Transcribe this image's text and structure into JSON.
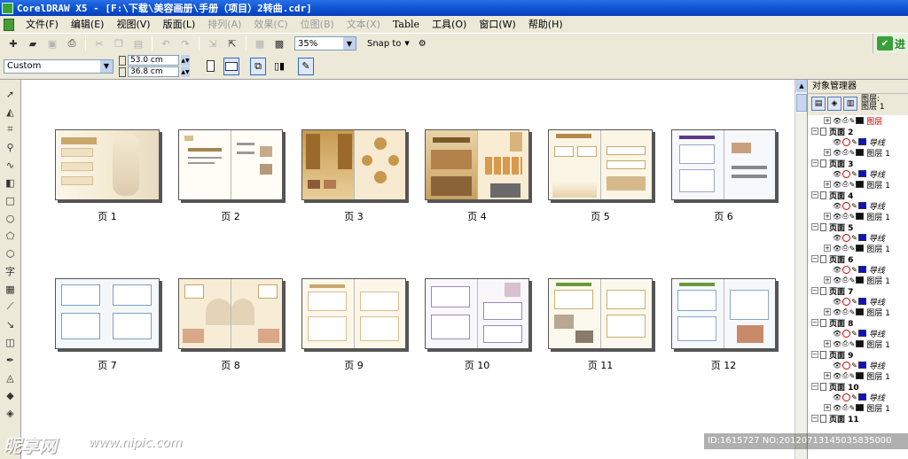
{
  "window": {
    "title": "CorelDRAW X5 - [F:\\下载\\美容画册\\手册（项目）2转曲.cdr]"
  },
  "menu": [
    {
      "label": "文件(F)",
      "enabled": true
    },
    {
      "label": "编辑(E)",
      "enabled": true
    },
    {
      "label": "视图(V)",
      "enabled": true
    },
    {
      "label": "版面(L)",
      "enabled": true
    },
    {
      "label": "排列(A)",
      "enabled": false
    },
    {
      "label": "效果(C)",
      "enabled": false
    },
    {
      "label": "位图(B)",
      "enabled": false
    },
    {
      "label": "文本(X)",
      "enabled": false
    },
    {
      "label": "Table",
      "enabled": true
    },
    {
      "label": "工具(O)",
      "enabled": true
    },
    {
      "label": "窗口(W)",
      "enabled": true
    },
    {
      "label": "帮助(H)",
      "enabled": true
    }
  ],
  "toolbar": {
    "zoom_value": "35%",
    "snap_label": "Snap to",
    "goto_label": "进"
  },
  "property_bar": {
    "preset": "Custom",
    "width": "53.0 cm",
    "height": "36.8 cm"
  },
  "pages": [
    {
      "label": "页 1"
    },
    {
      "label": "页 2"
    },
    {
      "label": "页 3"
    },
    {
      "label": "页 4"
    },
    {
      "label": "页 5"
    },
    {
      "label": "页 6"
    },
    {
      "label": "页 7"
    },
    {
      "label": "页 8"
    },
    {
      "label": "页 9"
    },
    {
      "label": "页 10"
    },
    {
      "label": "页 11"
    },
    {
      "label": "页 12"
    }
  ],
  "object_manager": {
    "title": "对象管理器",
    "layer_header_1": "图层:",
    "layer_header_2": "图层 1",
    "top_layer_label": "图层",
    "page_groups": [
      {
        "page": "页面 2",
        "guides": "导线",
        "layer": "图层 1"
      },
      {
        "page": "页面 3",
        "guides": "导线",
        "layer": "图层 1"
      },
      {
        "page": "页面 4",
        "guides": "导线",
        "layer": "图层 1"
      },
      {
        "page": "页面 5",
        "guides": "导线",
        "layer": "图层 1"
      },
      {
        "page": "页面 6",
        "guides": "导线",
        "layer": "图层 1"
      },
      {
        "page": "页面 7",
        "guides": "导线",
        "layer": "图层 1"
      },
      {
        "page": "页面 8",
        "guides": "导线",
        "layer": "图层 1"
      },
      {
        "page": "页面 9",
        "guides": "导线",
        "layer": "图层 1"
      },
      {
        "page": "页面 10",
        "guides": "导线",
        "layer": "图层 1"
      },
      {
        "page": "页面 11",
        "guides": "",
        "layer": ""
      }
    ]
  },
  "overlay": {
    "watermark": "昵享网",
    "watermark_url": "www.nipic.com",
    "id_text": "ID:1615727 NO:20120713145035835000"
  },
  "colors": {
    "titlebar": "#0a4fd0",
    "guide_swatch": "#1010c8",
    "layer_swatch": "#111111",
    "top_layer_text": "#cc0000"
  }
}
